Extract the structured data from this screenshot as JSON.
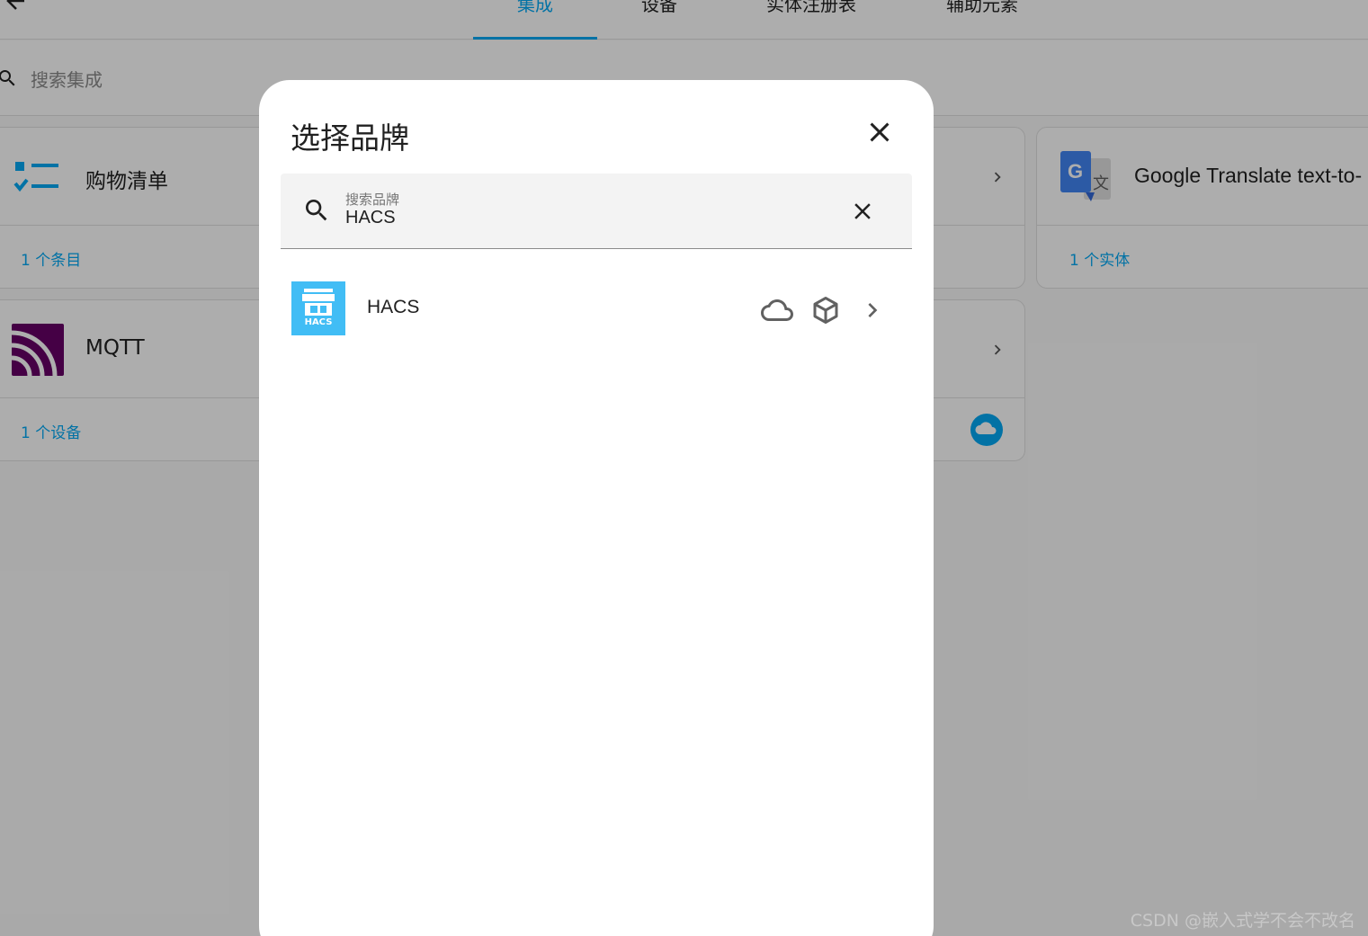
{
  "tabs": [
    "集成",
    "设备",
    "实体注册表",
    "辅助元素"
  ],
  "search": {
    "placeholder": "搜索集成"
  },
  "cards": {
    "shopping": {
      "title": "购物清单",
      "link": "1 个条目"
    },
    "mqtt": {
      "title": "MQTT",
      "link": "1 个设备"
    },
    "google": {
      "title": "Google Translate text-to-",
      "link": "1 个实体"
    }
  },
  "dialog": {
    "title": "选择品牌",
    "field_label": "搜索品牌",
    "field_value": "HACS",
    "results": [
      {
        "name": "HACS",
        "logo_text": "HACS"
      }
    ]
  },
  "icons": {
    "back": "arrow-left-icon",
    "search": "magnify-icon",
    "close": "close-icon",
    "clear": "close-icon",
    "cloud": "cloud-outline-icon",
    "package": "package-variant-icon",
    "chevron": "chevron-right-icon",
    "cloud_badge": "cloud-circle-icon"
  },
  "colors": {
    "accent": "#03a9f4",
    "hacs_logo": "#41bdf5",
    "mqtt_logo": "#660066",
    "google_blue": "#4285f4",
    "scrim": "rgba(0,0,0,0.32)"
  },
  "watermark": "CSDN @嵌入式学不会不改名"
}
